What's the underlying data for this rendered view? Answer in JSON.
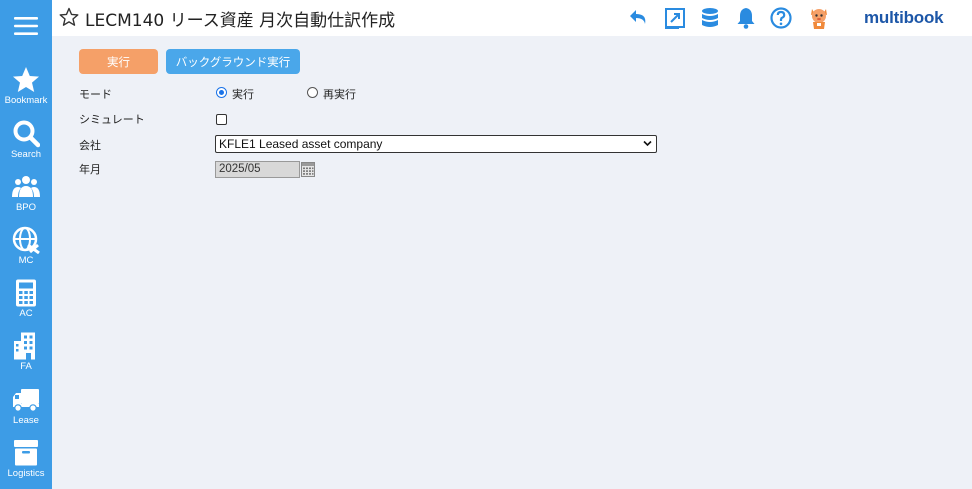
{
  "sidebar": {
    "items": [
      {
        "label": "Bookmark",
        "icon": "star-icon"
      },
      {
        "label": "Search",
        "icon": "search-icon"
      },
      {
        "label": "BPO",
        "icon": "people-icon"
      },
      {
        "label": "MC",
        "icon": "globe-icon"
      },
      {
        "label": "AC",
        "icon": "calculator-icon"
      },
      {
        "label": "FA",
        "icon": "building-icon"
      },
      {
        "label": "Lease",
        "icon": "truck-icon"
      },
      {
        "label": "Logistics",
        "icon": "box-icon"
      }
    ]
  },
  "header": {
    "title": "LECM140 リース資産 月次自動仕訳作成",
    "brand": "multibook",
    "icons": [
      "undo-icon",
      "external-link-icon",
      "database-icon",
      "bell-icon",
      "help-icon",
      "mascot-icon"
    ]
  },
  "toolbar": {
    "run_label": "実行",
    "background_run_label": "バックグラウンド実行"
  },
  "form": {
    "mode_label": "モード",
    "mode_options": [
      "実行",
      "再実行"
    ],
    "mode_selected": "実行",
    "simulate_label": "シミュレート",
    "simulate_checked": false,
    "company_label": "会社",
    "company_value": "KFLE1 Leased asset company",
    "period_label": "年月",
    "period_value": "2025/05"
  },
  "colors": {
    "sidebar": "#3d9ce6",
    "run_button": "#f5a068",
    "background_button": "#4aa7ea",
    "brand": "#1d57a8",
    "header_icon": "#2a8be0"
  }
}
